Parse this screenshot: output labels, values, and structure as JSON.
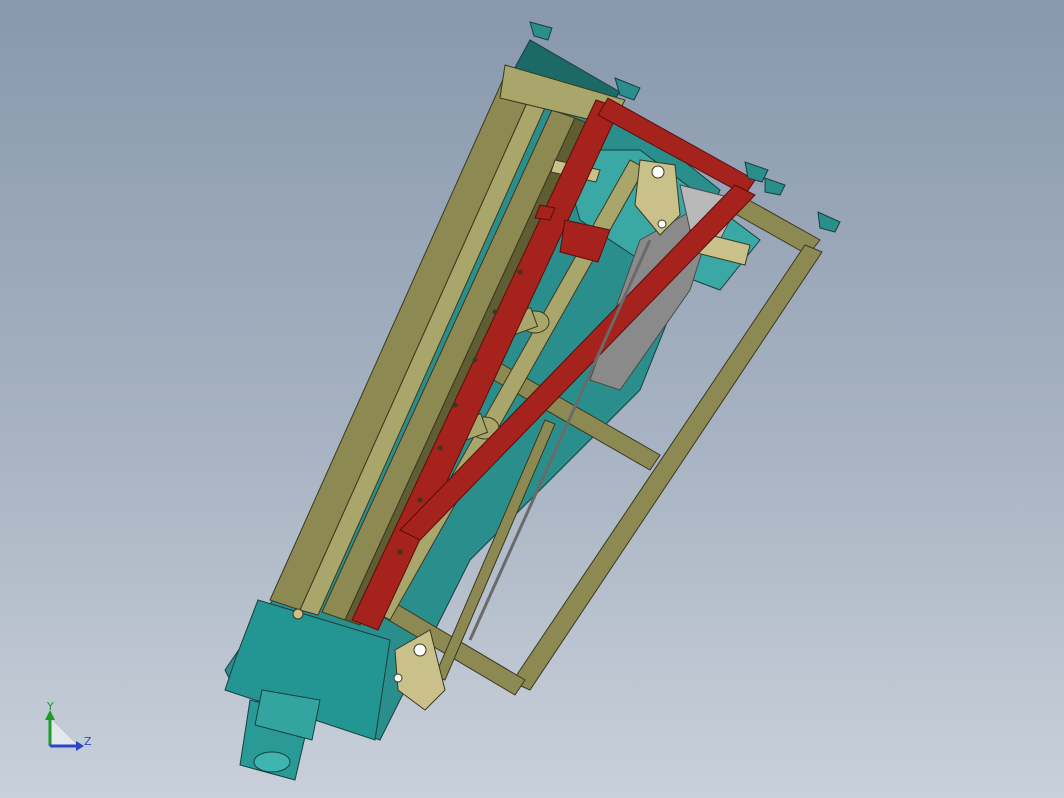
{
  "viewport": {
    "background_top": "#8898ad",
    "background_bottom": "#c9d0da"
  },
  "model": {
    "colors": {
      "frame_olive": "#8c8a52",
      "frame_olive_light": "#a8a66a",
      "frame_olive_dark": "#5f5d32",
      "brace_red": "#a5221d",
      "brace_red_dark": "#6e1210",
      "body_teal": "#2a8f8c",
      "body_teal_light": "#3aa8a4",
      "body_teal_dark": "#1c6a68",
      "plate_gray": "#8a8a8a",
      "plate_gray_light": "#b9b9b9",
      "bracket_beige": "#c9c08a"
    }
  },
  "triad": {
    "icon": "coordinate-triad-icon",
    "y_label": "Y",
    "z_label": "Z",
    "y_color": "#1c9a2a",
    "z_color": "#2a46c8"
  }
}
